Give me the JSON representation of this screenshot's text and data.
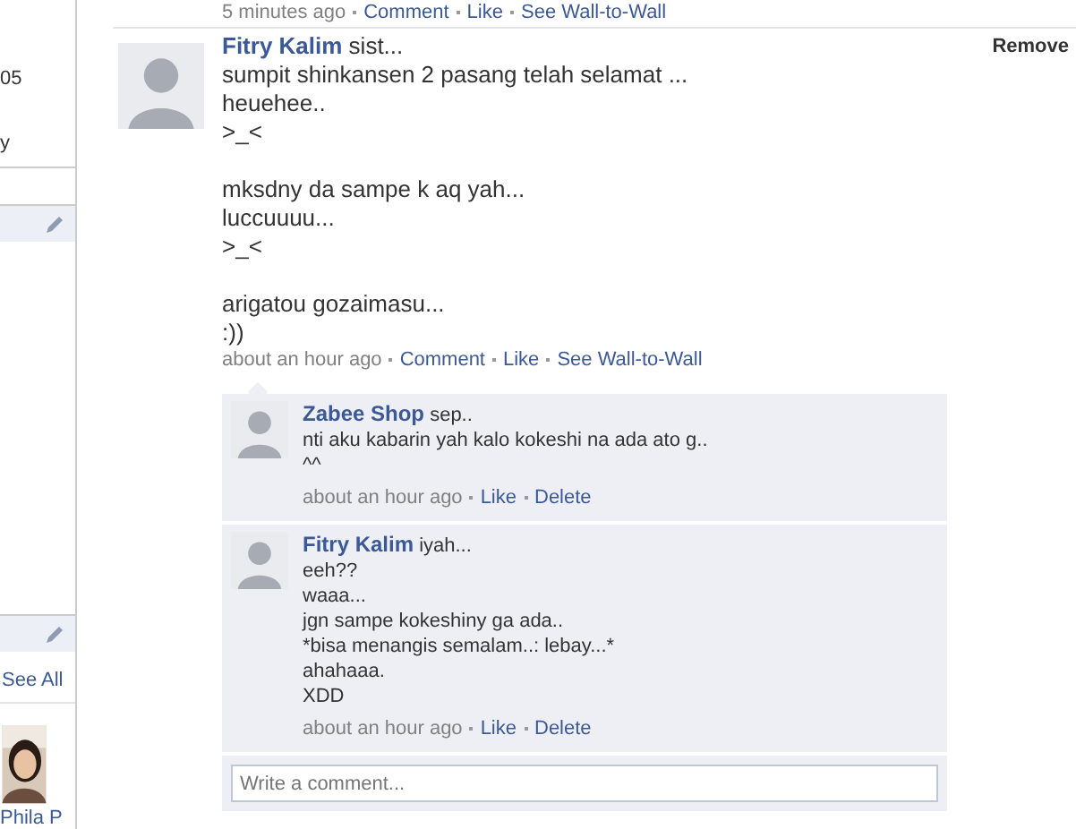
{
  "previous_post": {
    "time": "5 minutes ago",
    "actions": [
      "Comment",
      "Like",
      "See Wall-to-Wall"
    ]
  },
  "sidebar": {
    "fragments": [
      "05",
      "y"
    ],
    "see_all": "See All",
    "friend": {
      "name": "Phila P"
    }
  },
  "post": {
    "author": "Fitry Kalim",
    "text": "sist...\nsumpit shinkansen 2 pasang telah selamat ...\nheuehee..\n>_<\n\nmksdny da sampe k aq yah...\nluccuuuu...\n>_<\n\narigatou gozaimasu...\n:))",
    "remove": "Remove",
    "time": "about an hour ago",
    "actions": [
      "Comment",
      "Like",
      "See Wall-to-Wall"
    ],
    "comments": [
      {
        "author": "Zabee Shop",
        "text": "sep..\nnti aku kabarin yah kalo kokeshi na ada ato g..\n^^",
        "time": "about an hour ago",
        "actions": [
          "Like",
          "Delete"
        ]
      },
      {
        "author": "Fitry Kalim",
        "text": "iyah...\neeh??\nwaaa...\njgn sampe kokeshiny ga ada..\n*bisa menangis semalam..: lebay...*\nahahaaa.\nXDD",
        "time": "about an hour ago",
        "actions": [
          "Like",
          "Delete"
        ]
      }
    ],
    "comment_field": {
      "placeholder": "Write a comment..."
    }
  }
}
